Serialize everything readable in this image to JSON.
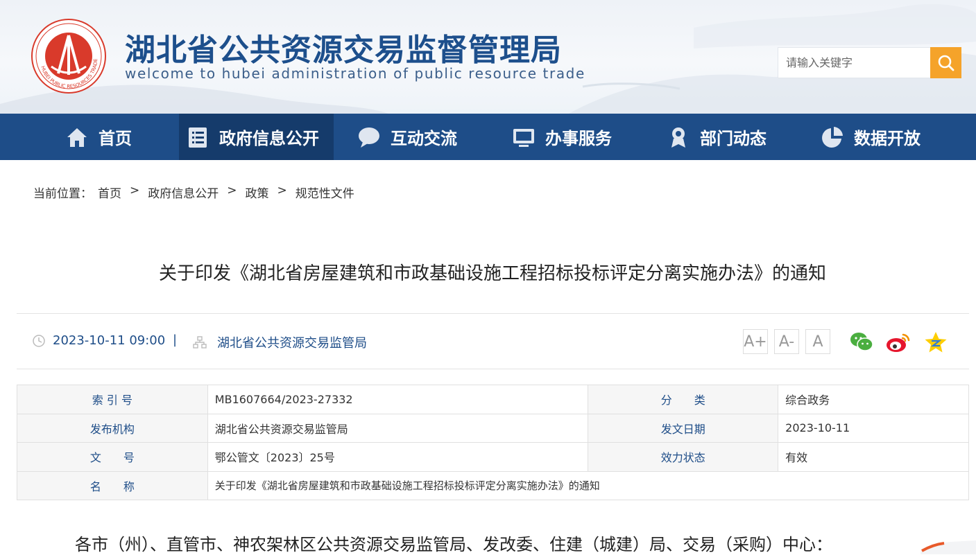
{
  "header": {
    "title": "湖北省公共资源交易监督管理局",
    "subtitle": "welcome to hubei administration of public resource trade",
    "logo_text": "HUBEI PUBLIC RESOURCES TRADE"
  },
  "search": {
    "placeholder": "请输入关键字",
    "icon": "search-icon"
  },
  "nav": {
    "items": [
      {
        "label": "首页",
        "icon": "home-icon"
      },
      {
        "label": "政府信息公开",
        "icon": "document-list-icon",
        "active": true
      },
      {
        "label": "互动交流",
        "icon": "chat-bubble-icon"
      },
      {
        "label": "办事服务",
        "icon": "monitor-icon"
      },
      {
        "label": "部门动态",
        "icon": "person-pin-icon"
      },
      {
        "label": "数据开放",
        "icon": "pie-chart-icon"
      }
    ]
  },
  "breadcrumb": {
    "prefix": "当前位置：",
    "items": [
      "首页",
      "政府信息公开",
      "政策",
      "规范性文件"
    ],
    "separator": ">"
  },
  "article": {
    "title": "关于印发《湖北省房屋建筑和市政基础设施工程招标投标评定分离实施办法》的通知",
    "date": "2023-10-11 09:00",
    "meta_separator": "|",
    "source": "湖北省公共资源交易监管局",
    "font_buttons": [
      "A+",
      "A-",
      "A"
    ],
    "share": [
      "wechat-icon",
      "weibo-icon",
      "qzone-icon"
    ]
  },
  "info_table": {
    "rows": [
      {
        "k1": "索 引 号",
        "v1": "MB1607664/2023-27332",
        "k2": "分　　类",
        "v2": "综合政务"
      },
      {
        "k1": "发布机构",
        "v1": "湖北省公共资源交易监管局",
        "k2": "发文日期",
        "v2": "2023-10-11"
      },
      {
        "k1": "文　　号",
        "v1": "鄂公管文〔2023〕25号",
        "k2": "效力状态",
        "v2": "有效"
      }
    ],
    "name_row": {
      "k": "名　　称",
      "v": "关于印发《湖北省房屋建筑和市政基础设施工程招标投标评定分离实施办法》的通知"
    }
  },
  "body": {
    "first_line": "各市（州）、直管市、神农架林区公共资源交易监管局、发改委、住建（城建）局、交易（采购）中心："
  },
  "colors": {
    "nav_bg": "#1e4d88",
    "nav_active": "#153b6b",
    "search_button": "#f5a32a",
    "logo_red": "#d93a2b",
    "title_blue": "#1d4f8c"
  }
}
